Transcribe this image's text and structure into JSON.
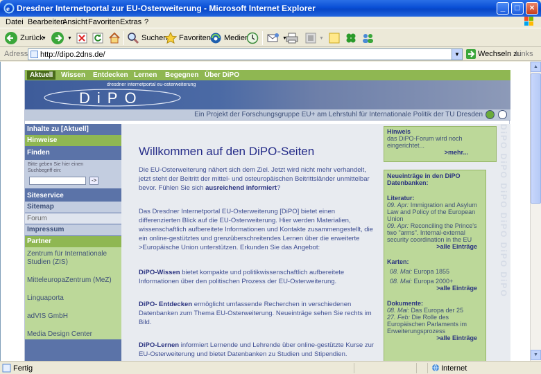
{
  "window": {
    "title": "Dresdner Internetportal zur EU-Osterweiterung - Microsoft Internet Explorer"
  },
  "menu": [
    "Datei",
    "Bearbeiten",
    "Ansicht",
    "Favoriten",
    "Extras",
    "?"
  ],
  "toolbar": {
    "back_label": "Zurück",
    "search_label": "Suchen",
    "favorites_label": "Favoriten",
    "media_label": "Medien"
  },
  "address": {
    "label": "Adresse",
    "url": "http://dipo.2dns.de/",
    "go_label": "Wechseln zu",
    "links_label": "Links"
  },
  "site": {
    "tabs": [
      "Aktuell",
      "Wissen",
      "Entdecken",
      "Lernen",
      "Begegnen",
      "Über DiPO"
    ],
    "subtitle": "dresdner internetportal eu-osterweiterung",
    "logo_text": "DiPO",
    "project_text": "Ein Projekt der Forschungsgruppe EU+ am Lehrstuhl für Internationale Politik der TU Dresden",
    "sidebar": {
      "inhalte": "Inhalte zu [Aktuell]",
      "hinweise": "Hinweise",
      "finden": "Finden",
      "search_hint": "Bitte geben Sie hier einen Suchbegriff ein:",
      "search_btn": "->",
      "siteservice": "Siteservice",
      "sitemap": "Sitemap",
      "forum": "Forum",
      "impressum": "Impressum",
      "partner": "Partner",
      "partners": [
        "Zentrum für Internationale Studien (ZIS)",
        "MitteleuropaZentrum (MeZ)",
        "Linguaporta",
        "adVIS GmbH",
        "Media Design Center"
      ]
    },
    "main": {
      "heading": "Willkommen auf den DiPO-Seiten",
      "p1": "Die EU-Osterweiterung nähert sich dem Ziel. Jetzt wird nicht mehr verhandelt, jetzt steht der Beitritt der mittel- und osteuropäischen Beitrittsländer unmittelbar bevor. Fühlen Sie sich ",
      "p1_bold": "ausreichend informiert",
      "p1_end": "?",
      "p2": "Das Dresdner Internetportal EU-Osterweiterung [DiPO] bietet einen differenzierten Blick auf die EU-Osterweiterung. Hier werden Materialien, wissenschaftlich aufbereitete Informationen und Kontakte zusammengestellt, die ein online-gestütztes und grenzüberschreitendes Lernen über die erweiterte >Europäische Union unterstützen. Erkunden Sie das Angebot:",
      "p3_bold": "DiPO-Wissen",
      "p3": " bietet kompakte und politikwissenschaftlich aufbereitete Informationen über den politischen Prozess der EU-Osterweiterung.",
      "p4_bold": "DiPO- Entdecken",
      "p4": " ermöglicht umfassende Recherchen in verschiedenen Datenbanken zum Thema EU-Osterweiterung. Neueinträge sehen Sie rechts im Bild.",
      "p5_bold": "DiPO-Lernen",
      "p5": " informiert Lernende und Lehrende über online-gestützte Kurse zur EU-Osterweiterung und bietet Datenbanken zu Studien und Stipendien."
    },
    "right": {
      "hinweis_title": "Hinweis",
      "hinweis_text": "das DiPO-Forum wird noch eingerichtet...",
      "hinweis_more": ">mehr...",
      "neu_title": "Neueinträge in den DiPO Datenbanken:",
      "lit_title": "Literatur:",
      "lit1_date": "09. Apr:",
      "lit1": " Immigration and Asylum Law and Policy of the European Union",
      "lit2_date": "09. Apr:",
      "lit2": " Reconciling the Prince's two \"arms\". Internal-external security coordination in the EU",
      "lit_more": ">alle Einträge",
      "karten_title": "Karten:",
      "k1_date": "08. Mai:",
      "k1": " Europa 1855",
      "k2_date": "08. Mai:",
      "k2": " Europa 2000+",
      "karten_more": ">alle Einträge",
      "dok_title": "Dokumente:",
      "d1_date": "08. Mai:",
      "d1": " Das Europa der 25",
      "d2_date": "27. Feb:",
      "d2": " Die Rolle des Europäischen Parlaments im Erweiterungsprozess",
      "dok_more": ">alle Einträge",
      "watermark": "DiPO DiPO DiPO DiPO DiPO DiPO"
    }
  },
  "status": {
    "left": "Fertig",
    "zone": "Internet"
  }
}
